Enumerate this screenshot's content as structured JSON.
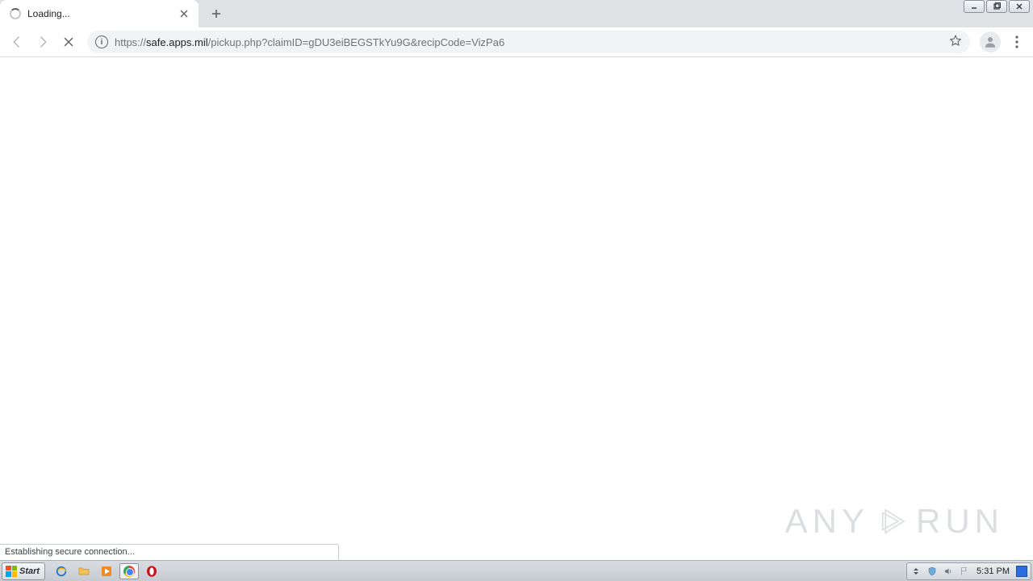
{
  "window_controls": {
    "minimize": "—",
    "maximize": "❐",
    "close": "✕"
  },
  "tab": {
    "title": "Loading..."
  },
  "toolbar": {
    "new_tab_label": "+"
  },
  "url": {
    "scheme": "https://",
    "host": "safe.apps.mil",
    "path": "/pickup.php?claimID=gDU3eiBEGSTkYu9G&recipCode=VizPa6"
  },
  "status_text": "Establishing secure connection...",
  "watermark": {
    "left": "ANY",
    "right": "RUN"
  },
  "taskbar": {
    "start_label": "Start",
    "clock": "5:31 PM"
  }
}
